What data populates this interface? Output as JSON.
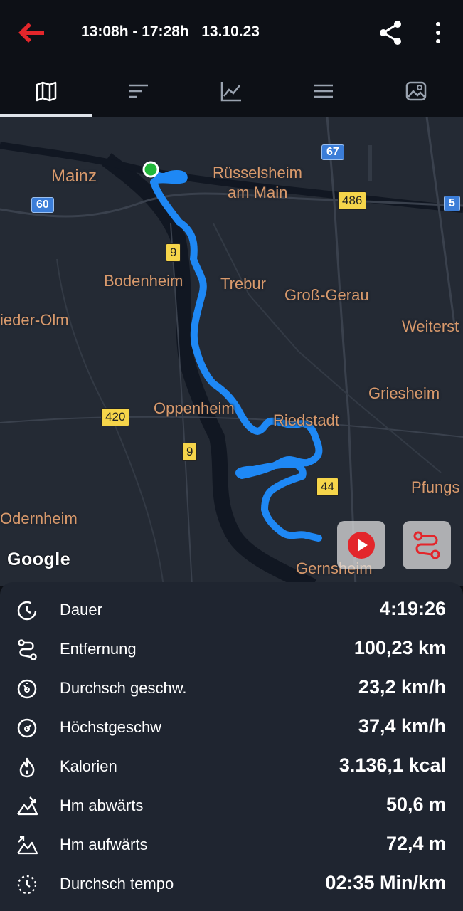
{
  "header": {
    "title": "13:08h - 17:28h   13.10.23",
    "back_icon": "back-arrow-icon",
    "share_icon": "share-icon",
    "more_icon": "more-vertical-icon",
    "accent": "#e3262b"
  },
  "tabs": [
    {
      "name": "map",
      "icon": "map-icon",
      "selected": true
    },
    {
      "name": "summary",
      "icon": "summary-lines-icon",
      "selected": false
    },
    {
      "name": "chart",
      "icon": "chart-icon",
      "selected": false
    },
    {
      "name": "list",
      "icon": "list-icon",
      "selected": false
    },
    {
      "name": "photos",
      "icon": "image-icon",
      "selected": false
    }
  ],
  "map": {
    "places": [
      "Mainz",
      "Rüsselsheim",
      "am Main",
      "Bodenheim",
      "Trebur",
      "Groß-Gerau",
      "ieder-Olm",
      "Weiterst",
      "Griesheim",
      "Oppenheim",
      "Riedstadt",
      "Pfungs",
      "Odernheim",
      "Gernsheim"
    ],
    "roads": [
      "67",
      "486",
      "60",
      "5",
      "9",
      "420",
      "9",
      "44"
    ],
    "attribution": "Google",
    "route_color": "#1e88f5",
    "start_marker_color": "#22b83a",
    "play_button_icon": "play-icon",
    "route_button_icon": "route-icon"
  },
  "stats": [
    {
      "icon": "timer-icon",
      "label": "Dauer",
      "value": "4:19:26"
    },
    {
      "icon": "distance-icon",
      "label": "Entfernung",
      "value": "100,23 km"
    },
    {
      "icon": "speedometer-icon",
      "label": "Durchsch geschw.",
      "value": "23,2 km/h"
    },
    {
      "icon": "speedometer-max-icon",
      "label": "Höchstgeschw",
      "value": "37,4 km/h"
    },
    {
      "icon": "flame-icon",
      "label": "Kalorien",
      "value": "3.136,1 kcal"
    },
    {
      "icon": "descent-icon",
      "label": "Hm abwärts",
      "value": "50,6 m"
    },
    {
      "icon": "ascent-icon",
      "label": "Hm aufwärts",
      "value": "72,4 m"
    },
    {
      "icon": "pace-icon",
      "label": "Durchsch tempo",
      "value": "02:35 Min/km"
    }
  ]
}
